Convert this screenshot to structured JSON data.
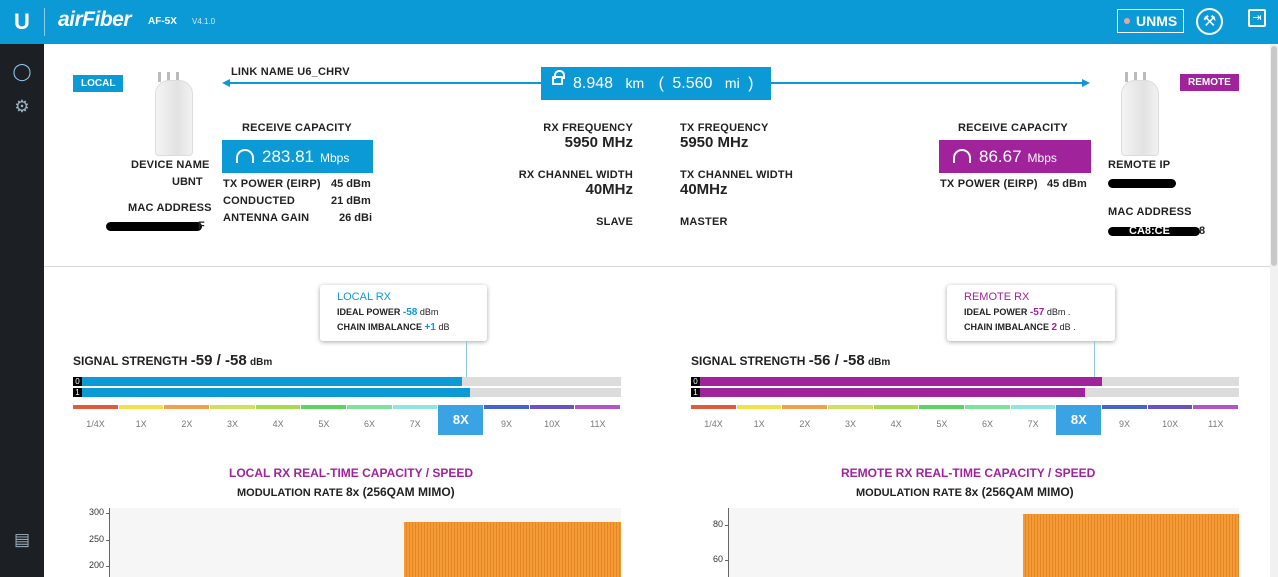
{
  "header": {
    "logo": "U",
    "brand": "airFiber",
    "model": "AF-5X",
    "version": "V4.1.0",
    "unms_label": "UNMS",
    "tools_icon": "tools-icon",
    "logout_icon": "logout-icon",
    "color": "#0c9ad6"
  },
  "sidebar": {
    "items": [
      {
        "icon": "dashboard-icon"
      },
      {
        "icon": "settings-gears-icon"
      },
      {
        "icon": "log-icon"
      }
    ]
  },
  "link": {
    "local_badge": "LOCAL",
    "remote_badge": "REMOTE",
    "link_name_label": "LINK NAME",
    "link_name": "U6_CHRV",
    "distance_km": "8.948",
    "km_unit": "km",
    "distance_mi": "5.560",
    "mi_unit": "mi",
    "open_paren": "(",
    "close_paren": ")"
  },
  "local": {
    "device_name_label": "DEVICE NAME",
    "device_name": "UBNT",
    "mac_label": "MAC ADDRESS",
    "mac_visible": "F",
    "receive_capacity_label": "RECEIVE CAPACITY",
    "capacity": "283.81",
    "capacity_unit": "Mbps",
    "tx_power_label": "TX POWER (EIRP)",
    "tx_power": "45 dBm",
    "conducted_label": "CONDUCTED",
    "conducted": "21 dBm",
    "antenna_gain_label": "ANTENNA GAIN",
    "antenna_gain": "26 dBi",
    "color": "#0c9ad6"
  },
  "center": {
    "rx_freq_label": "RX FREQUENCY",
    "rx_freq": "5950 MHz",
    "tx_freq_label": "TX FREQUENCY",
    "tx_freq": "5950 MHz",
    "rx_width_label": "RX CHANNEL WIDTH",
    "rx_width": "40MHz",
    "tx_width_label": "TX CHANNEL WIDTH",
    "tx_width": "40MHz",
    "local_role": "SLAVE",
    "remote_role": "MASTER"
  },
  "remote": {
    "receive_capacity_label": "RECEIVE CAPACITY",
    "capacity": "86.67",
    "capacity_unit": "Mbps",
    "tx_power_label": "TX POWER (EIRP)",
    "tx_power": "45 dBm",
    "remote_ip_label": "REMOTE IP",
    "mac_label": "MAC ADDRESS",
    "mac_visible": "CA8:CE",
    "mac_suffix": "8",
    "color": "#a0239b"
  },
  "local_rx": {
    "title": "LOCAL RX",
    "ideal_power_label": "IDEAL POWER",
    "ideal_power": "-58",
    "ideal_power_unit": "dBm",
    "chain_imbalance_label": "CHAIN IMBALANCE",
    "chain_imbalance": "+1",
    "chain_imbalance_unit": "dB",
    "signal_label": "SIGNAL STRENGTH",
    "signal_value": "-59 / -58",
    "signal_unit": "dBm",
    "chain0_fill": 0.705,
    "chain1_fill": 0.72,
    "chart_title_a": "LOCAL RX",
    "chart_title_b": "REAL-TIME CAPACITY / SPEED",
    "modulation_label": "MODULATION RATE",
    "modulation": "8x (256QAM MIMO)",
    "y_ticks": [
      "300",
      "250",
      "200"
    ]
  },
  "remote_rx": {
    "title": "REMOTE RX",
    "ideal_power_label": "IDEAL POWER",
    "ideal_power": "-57",
    "ideal_power_unit": "dBm .",
    "chain_imbalance_label": "CHAIN IMBALANCE",
    "chain_imbalance": "2",
    "chain_imbalance_unit": "dB .",
    "signal_label": "SIGNAL STRENGTH",
    "signal_value": "-56 / -58",
    "signal_unit": "dBm",
    "chain0_fill": 0.745,
    "chain1_fill": 0.715,
    "chart_title_a": "REMOTE RX",
    "chart_title_b": "REAL-TIME CAPACITY / SPEED",
    "modulation_label": "MODULATION RATE",
    "modulation": "8x (256QAM MIMO)",
    "y_ticks": [
      "80",
      "60"
    ]
  },
  "scale": {
    "labels": [
      "1/4X",
      "1X",
      "2X",
      "3X",
      "4X",
      "5X",
      "6X",
      "7X",
      "8X",
      "9X",
      "10X",
      "11X"
    ],
    "selected": "8X",
    "colors": [
      "#e05b3c",
      "#f4e04a",
      "#f2a04a",
      "#cfe060",
      "#a6dc4c",
      "#5bd460",
      "#7be39a",
      "#8fe6dc",
      "#4aa4e8",
      "#4465c9",
      "#6b52c4",
      "#b153c9"
    ]
  },
  "chart_data": [
    {
      "type": "bar",
      "title": "LOCAL RX REAL-TIME CAPACITY / SPEED",
      "y_ticks": [
        200,
        250,
        300
      ],
      "ylim": [
        180,
        310
      ],
      "series": [
        {
          "values": [
            283.81
          ]
        }
      ]
    },
    {
      "type": "bar",
      "title": "REMOTE RX REAL-TIME CAPACITY / SPEED",
      "y_ticks": [
        60,
        80
      ],
      "ylim": [
        50,
        90
      ],
      "series": [
        {
          "values": [
            86.67
          ]
        }
      ]
    }
  ]
}
